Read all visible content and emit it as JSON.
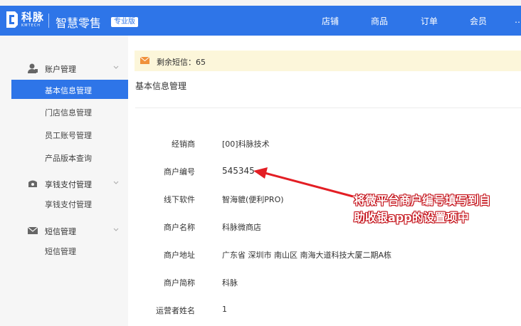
{
  "header": {
    "logo_text": "科脉",
    "logo_sub": "KMTECH",
    "app_title": "智慧零售",
    "edition": "专业版",
    "nav": [
      "店铺",
      "商品",
      "订单",
      "会员",
      "…"
    ]
  },
  "sidebar": {
    "groups": [
      {
        "icon": "user-icon",
        "label": "账户管理",
        "items": [
          "基本信息管理",
          "门店信息管理",
          "员工账号管理",
          "产品版本查询"
        ]
      },
      {
        "icon": "wallet-icon",
        "label": "享钱支付管理",
        "items": [
          "享钱支付管理"
        ]
      },
      {
        "icon": "mail-icon",
        "label": "短信管理",
        "items": [
          "短信管理"
        ]
      }
    ],
    "active_item": "基本信息管理"
  },
  "notice": {
    "text": "剩余短信：65"
  },
  "page": {
    "title": "基本信息管理"
  },
  "fields": [
    {
      "label": "经销商",
      "value": "[00]科脉技术"
    },
    {
      "label": "商户编号",
      "value": "545345"
    },
    {
      "label": "线下软件",
      "value": "智海貔(便利PRO)"
    },
    {
      "label": "商户名称",
      "value": "科脉微商店"
    },
    {
      "label": "商户地址",
      "value": "广东省 深圳市 南山区 南海大道科技大厦二期A栋"
    },
    {
      "label": "商户简称",
      "value": "科脉"
    },
    {
      "label": "运营者姓名",
      "value": "1"
    }
  ],
  "annotation": {
    "line1": "将微平台商户编号填写到自",
    "line2": "助收银app的设置项中"
  },
  "colors": {
    "brand": "#2e75e8",
    "notice_bg": "#fcf6da",
    "annotation": "#e31e24"
  }
}
